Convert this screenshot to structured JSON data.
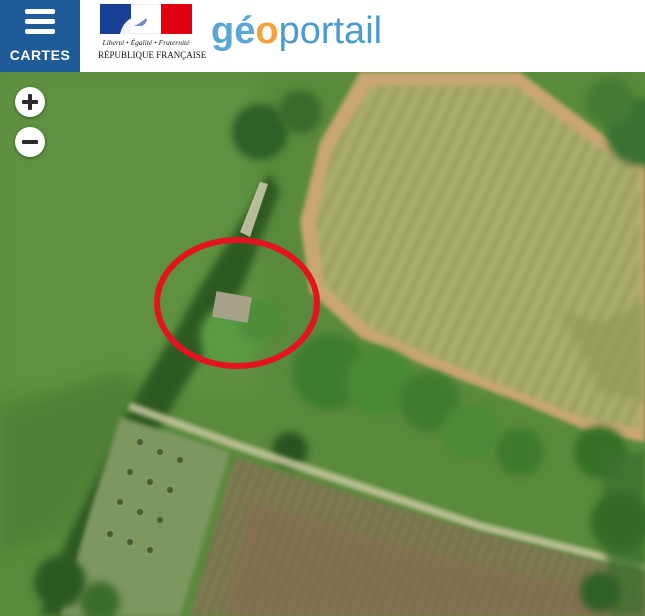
{
  "header": {
    "menu_label": "CARTES",
    "brand": {
      "part1": "gé",
      "part2": "o",
      "part3": "portail"
    },
    "republic_logo": {
      "motto": "Liberté • Égalité • Fraternité",
      "name": "RÉPUBLIQUE FRANÇAISE"
    }
  },
  "map": {
    "zoom_in_icon": "plus-icon",
    "zoom_out_icon": "minus-icon",
    "annotation": {
      "shape": "ellipse",
      "color": "#e3141f"
    }
  },
  "colors": {
    "header_menu": "#1f5a99",
    "brand_blue": "#5aa6d6",
    "brand_orange": "#f3a33b",
    "annotation_red": "#e3141f"
  }
}
